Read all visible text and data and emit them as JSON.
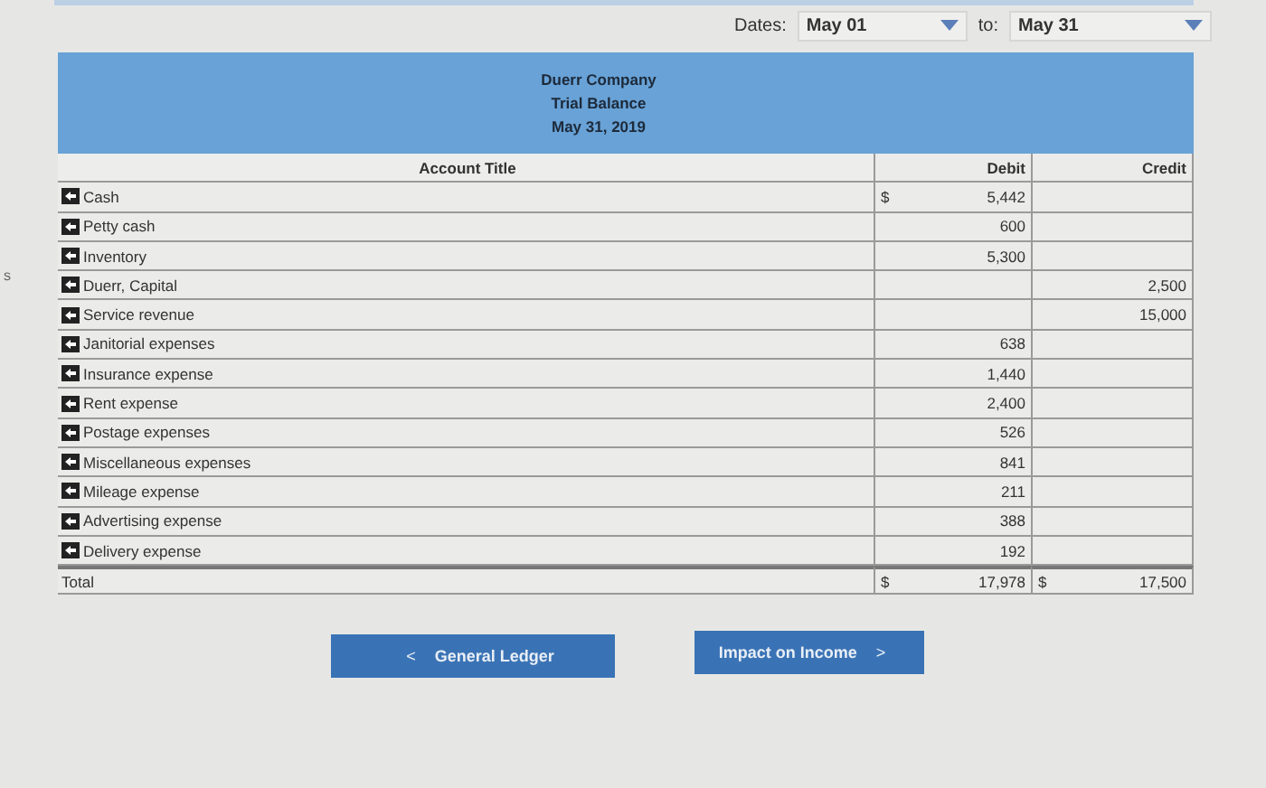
{
  "edge_text": "s",
  "dates": {
    "label": "Dates:",
    "from": "May 01",
    "to_label": "to:",
    "to": "May 31"
  },
  "report_header": [
    "Duerr Company",
    "Trial Balance",
    "May 31, 2019"
  ],
  "columns": [
    "Account Title",
    "Debit",
    "Credit"
  ],
  "rows": [
    {
      "kind": "account",
      "title": "Cash",
      "debit_prefix": "$",
      "debit": "5,442",
      "credit_prefix": "",
      "credit": ""
    },
    {
      "kind": "account",
      "title": "Petty cash",
      "debit_prefix": "",
      "debit": "600",
      "credit_prefix": "",
      "credit": ""
    },
    {
      "kind": "account",
      "title": "Inventory",
      "debit_prefix": "",
      "debit": "5,300",
      "credit_prefix": "",
      "credit": ""
    },
    {
      "kind": "account",
      "title": "Duerr, Capital",
      "debit_prefix": "",
      "debit": "",
      "credit_prefix": "",
      "credit": "2,500"
    },
    {
      "kind": "account",
      "title": "Service revenue",
      "debit_prefix": "",
      "debit": "",
      "credit_prefix": "",
      "credit": "15,000"
    },
    {
      "kind": "account",
      "title": "Janitorial expenses",
      "debit_prefix": "",
      "debit": "638",
      "credit_prefix": "",
      "credit": ""
    },
    {
      "kind": "account",
      "title": "Insurance expense",
      "debit_prefix": "",
      "debit": "1,440",
      "credit_prefix": "",
      "credit": ""
    },
    {
      "kind": "account",
      "title": "Rent expense",
      "debit_prefix": "",
      "debit": "2,400",
      "credit_prefix": "",
      "credit": ""
    },
    {
      "kind": "account",
      "title": "Postage expenses",
      "debit_prefix": "",
      "debit": "526",
      "credit_prefix": "",
      "credit": ""
    },
    {
      "kind": "account",
      "title": "Miscellaneous expenses",
      "debit_prefix": "",
      "debit": "841",
      "credit_prefix": "",
      "credit": ""
    },
    {
      "kind": "account",
      "title": "Mileage expense",
      "debit_prefix": "",
      "debit": "211",
      "credit_prefix": "",
      "credit": ""
    },
    {
      "kind": "account",
      "title": "Advertising expense",
      "debit_prefix": "",
      "debit": "388",
      "credit_prefix": "",
      "credit": ""
    },
    {
      "kind": "account",
      "title": "Delivery expense",
      "debit_prefix": "",
      "debit": "192",
      "credit_prefix": "",
      "credit": ""
    },
    {
      "kind": "total",
      "title": "Total",
      "debit_prefix": "$",
      "debit": "17,978",
      "credit_prefix": "$",
      "credit": "17,500"
    }
  ],
  "buttons": [
    {
      "kind": "back",
      "chevron": "<",
      "label": "General Ledger"
    },
    {
      "kind": "forward",
      "chevron": ">",
      "label": "Impact on Income"
    }
  ]
}
